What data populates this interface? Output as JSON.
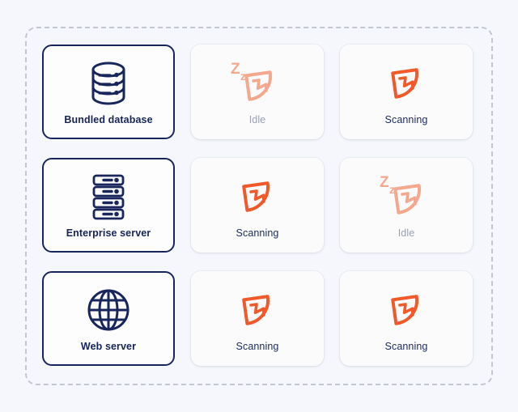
{
  "theme": {
    "page_background": "#f5f7fc",
    "navy": "#19265c",
    "orange_active": "#f0592a",
    "orange_idle": "#f4a88e",
    "idle_text": "#9aa1b4",
    "dashed_border": "#c2c7d0",
    "card_background": "#ffffff"
  },
  "board": {
    "name": "asset-scan-status-grid"
  },
  "assets": [
    {
      "id": "bundled-database",
      "label": "Bundled database",
      "icon": "database-icon"
    },
    {
      "id": "enterprise-server",
      "label": "Enterprise server",
      "icon": "server-rack-icon"
    },
    {
      "id": "web-server",
      "label": "Web server",
      "icon": "globe-icon"
    }
  ],
  "statuses": [
    {
      "id": "r1c1",
      "label": "Idle",
      "state": "idle",
      "icon": "radar-sleep-icon"
    },
    {
      "id": "r1c2",
      "label": "Scanning",
      "state": "scanning",
      "icon": "radar-scan-icon"
    },
    {
      "id": "r2c1",
      "label": "Scanning",
      "state": "scanning",
      "icon": "radar-scan-icon"
    },
    {
      "id": "r2c2",
      "label": "Idle",
      "state": "idle",
      "icon": "radar-sleep-icon"
    },
    {
      "id": "r3c1",
      "label": "Scanning",
      "state": "scanning",
      "icon": "radar-scan-icon"
    },
    {
      "id": "r3c2",
      "label": "Scanning",
      "state": "scanning",
      "icon": "radar-scan-icon"
    }
  ],
  "rows": [
    {
      "asset_index": 0,
      "status_indices": [
        0,
        1
      ]
    },
    {
      "asset_index": 1,
      "status_indices": [
        2,
        3
      ]
    },
    {
      "asset_index": 2,
      "status_indices": [
        4,
        5
      ]
    }
  ]
}
